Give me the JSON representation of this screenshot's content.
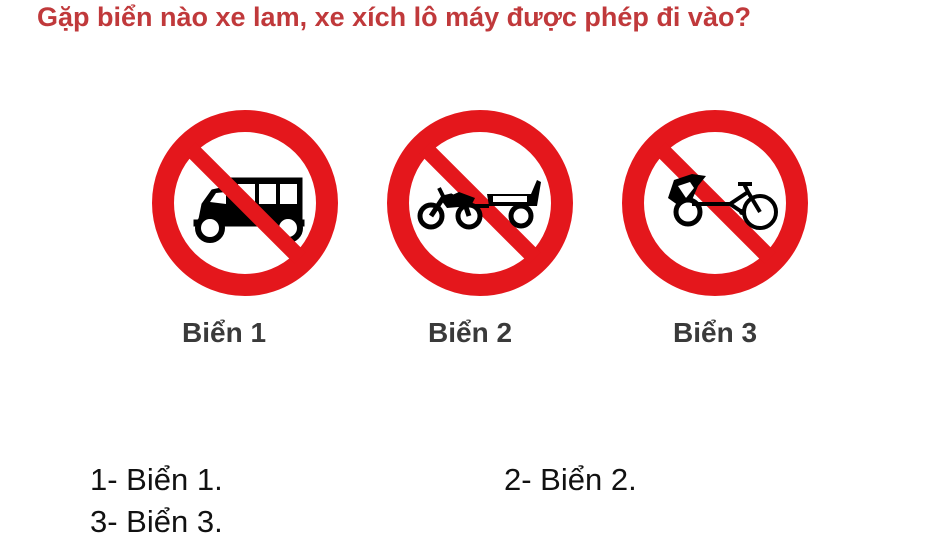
{
  "question": "Gặp biển nào xe lam, xe xích lô máy được phép đi vào?",
  "colors": {
    "question": "#c0393b",
    "sign_red": "#e4171c",
    "sign_white": "#ffffff",
    "symbol": "#000000"
  },
  "signs": [
    {
      "label": "Biển 1",
      "icon": "no-three-wheeled-lambro-sign-icon"
    },
    {
      "label": "Biển 2",
      "icon": "no-motorcycle-with-trailer-sign-icon"
    },
    {
      "label": "Biển 3",
      "icon": "no-cyclo-sign-icon"
    }
  ],
  "answers": [
    {
      "text": "1- Biển 1."
    },
    {
      "text": "2- Biển 2."
    },
    {
      "text": "3- Biển 3."
    }
  ]
}
